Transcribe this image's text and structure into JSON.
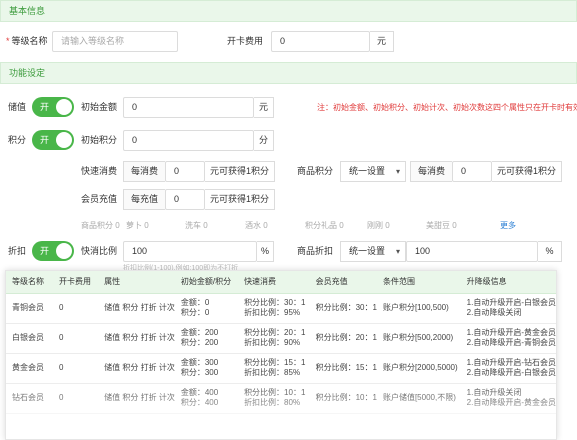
{
  "basic": {
    "title": "基本信息",
    "level_name_label": "等级名称",
    "level_name_placeholder": "请输入等级名称",
    "card_fee_label": "开卡费用",
    "card_fee_value": "0",
    "card_fee_unit": "元"
  },
  "function": {
    "title": "功能设定",
    "note": "注：初始金额、初始积分、初始计次、初始次数这四个属性只在开卡时有效",
    "stored_value": {
      "label": "储值",
      "toggle": "开",
      "initial_amount_label": "初始金额",
      "initial_amount_value": "0",
      "unit": "元"
    },
    "points": {
      "label": "积分",
      "toggle": "开",
      "initial_points_label": "初始积分",
      "initial_points_value": "0",
      "unit": "分",
      "quick_consume_label": "快速消费",
      "quick_consume_prefix": "每消费",
      "quick_consume_value": "0",
      "quick_consume_suffix": "元可获得1积分",
      "goods_points_label": "商品积分",
      "goods_points_select": "统一设置",
      "goods_prefix": "每消费",
      "goods_value": "0",
      "goods_suffix": "元可获得1积分",
      "recharge_label": "会员充值",
      "recharge_prefix": "每充值",
      "recharge_value": "0",
      "recharge_suffix": "元可获得1积分"
    },
    "stats": {
      "items": [
        "商品积分 0",
        "萝卜 0",
        "洗车 0",
        "酒水 0",
        "积分礼品 0",
        "刚刚 0",
        "美甜豆 0"
      ],
      "more": "更多"
    },
    "discount": {
      "label": "折扣",
      "toggle": "开",
      "quick_ratio_label": "快消比例",
      "quick_ratio_value": "100",
      "unit": "%",
      "goods_discount_label": "商品折扣",
      "goods_discount_select": "统一设置",
      "goods_discount_value": "100",
      "goods_unit": "%",
      "hint": "折扣比例(1-100),例如:100即为不打折"
    }
  },
  "table": {
    "headers": [
      "等级名称",
      "开卡费用",
      "属性",
      "初始金额/积分",
      "快速消费",
      "会员充值",
      "条件范围",
      "升降级信息"
    ],
    "rows": [
      {
        "name": "青铜会员",
        "fee": "0",
        "attrs": "储值 积分 打折 计次",
        "init_amount": "金额：0",
        "init_points": "积分：0",
        "quick_points": "积分比例：30：1",
        "quick_discount": "折扣比例：95%",
        "recharge": "积分比例：30：1",
        "range": "账户积分[100,500)",
        "up": "1.自动升级开启-白银会员",
        "down": "2.自动降级关闭"
      },
      {
        "name": "白银会员",
        "fee": "0",
        "attrs": "储值 积分 打折 计次",
        "init_amount": "金额：200",
        "init_points": "积分：200",
        "quick_points": "积分比例：20：1",
        "quick_discount": "折扣比例：90%",
        "recharge": "积分比例：20：1",
        "range": "账户积分[500,2000)",
        "up": "1.自动升级开启-黄金会员",
        "down": "2.自动降级开启-青铜会员"
      },
      {
        "name": "黄金会员",
        "fee": "0",
        "attrs": "储值 积分 打折 计次",
        "init_amount": "金额：300",
        "init_points": "积分：300",
        "quick_points": "积分比例：15：1",
        "quick_discount": "折扣比例：85%",
        "recharge": "积分比例：15：1",
        "range": "账户积分[2000,5000)",
        "up": "1.自动升级开启-钻石会员",
        "down": "2.自动降级开启-白银会员"
      },
      {
        "name": "钻石会员",
        "fee": "0",
        "attrs": "储值 积分 打折 计次",
        "init_amount": "金额：400",
        "init_points": "积分：400",
        "quick_points": "积分比例：10：1",
        "quick_discount": "折扣比例：80%",
        "recharge": "积分比例：10：1",
        "range": "账户储值[5000,不限)",
        "up": "1.自动升级关闭",
        "down": "2.自动降级开启-黄金会员"
      }
    ]
  }
}
